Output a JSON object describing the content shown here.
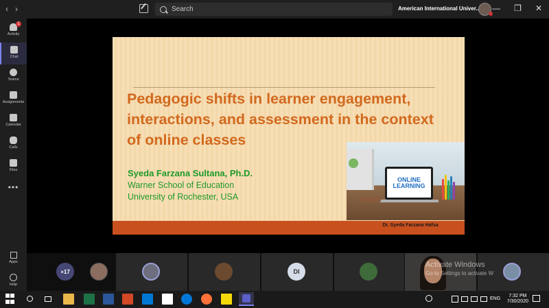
{
  "titlebar": {
    "back": "‹",
    "forward": "›",
    "search_placeholder": "Search",
    "org_name": "American International Univer...",
    "org_chevron": "⌄",
    "minimize": "—",
    "maximize": "❐",
    "close": "✕"
  },
  "rail": {
    "activity_badge": "1",
    "items": [
      {
        "label": "Activity"
      },
      {
        "label": "Chat"
      },
      {
        "label": "Teams"
      },
      {
        "label": "Assignments"
      },
      {
        "label": "Calendar"
      },
      {
        "label": "Calls"
      },
      {
        "label": "Files"
      }
    ],
    "more": "•••",
    "apps": "Apps",
    "help": "Help"
  },
  "slide": {
    "title": "Pedagogic shifts in learner engagement, interactions, and assessment in the context of online classes",
    "author": "Syeda Farzana Sultana, Ph.D.",
    "affiliation_1": "Warner School of Education",
    "affiliation_2": "University of Rochester, USA",
    "image_text": "ONLINE LEARNING",
    "footer": "Dr. Syeda Farzana Hafsa"
  },
  "participants": {
    "more_count": "+17",
    "initials": "DI"
  },
  "watermark": {
    "line1": "Activate Windows",
    "line2": "Go to Settings to activate W"
  },
  "taskbar": {
    "lang": "ENG",
    "time": "7:32 PM",
    "date": "7/30/2020"
  },
  "colors": {
    "accent": "#7b83eb",
    "slide_title": "#d2691e",
    "slide_author": "#1e9a2a",
    "slide_footer": "#c8501e"
  }
}
